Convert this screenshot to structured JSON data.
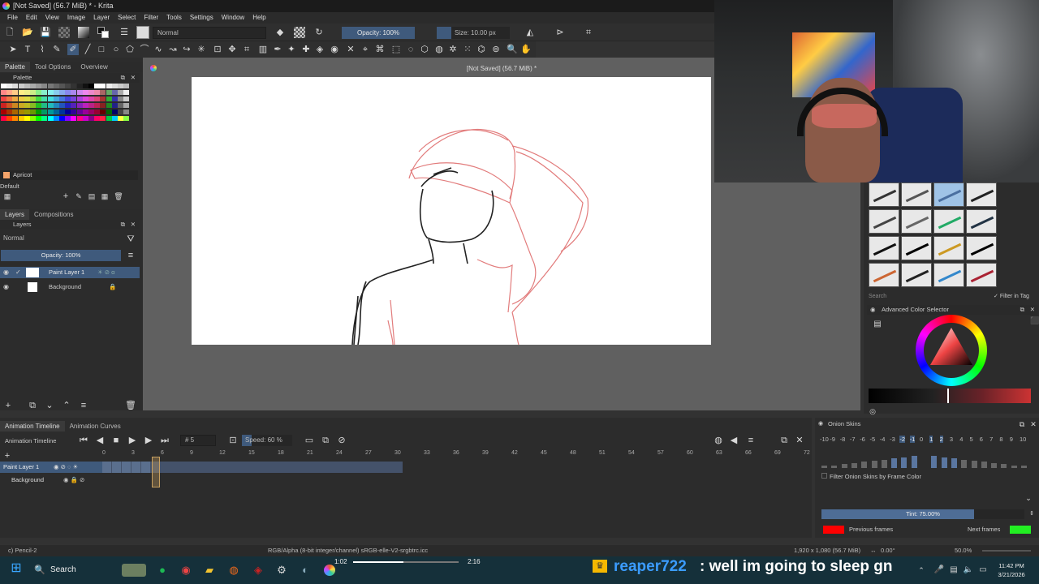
{
  "window": {
    "title": "[Not Saved]  (56.7 MiB) * - Krita"
  },
  "menu": [
    "File",
    "Edit",
    "View",
    "Image",
    "Layer",
    "Select",
    "Filter",
    "Tools",
    "Settings",
    "Window",
    "Help"
  ],
  "toolbar": {
    "blend_mode": "Normal",
    "opacity_label": "Opacity: 100%",
    "size_label": "Size: 10.00 px"
  },
  "left_tabs": [
    "Palette",
    "Tool Options",
    "Overview"
  ],
  "palette": {
    "title": "Palette",
    "selected_color_name": "Apricot",
    "palette_name": "Default"
  },
  "layers_tabs": [
    "Layers",
    "Compositions"
  ],
  "layers": {
    "title": "Layers",
    "blend_mode": "Normal",
    "opacity_label": "Opacity:  100%",
    "items": [
      {
        "name": "Paint Layer 1"
      },
      {
        "name": "Background"
      }
    ]
  },
  "document": {
    "title": "[Not Saved]  (56.7 MiB) *"
  },
  "brush_presets": {
    "search_placeholder": "Search",
    "filter_in_tag": "Filter in Tag"
  },
  "color_selector": {
    "title": "Advanced Color Selector"
  },
  "timeline": {
    "tabs": [
      "Animation Timeline",
      "Animation Curves"
    ],
    "title": "Animation Timeline",
    "frame_field": "5",
    "speed_label": "Speed: 60 %",
    "ruler": [
      "0",
      "3",
      "6",
      "9",
      "12",
      "15",
      "18",
      "21",
      "24",
      "27",
      "30",
      "33",
      "36",
      "39",
      "42",
      "45",
      "48",
      "51",
      "54",
      "57",
      "60",
      "63",
      "66",
      "69",
      "72"
    ],
    "layers": [
      "Paint Layer 1",
      "Background"
    ]
  },
  "onion": {
    "title": "Onion Skins",
    "numbers": [
      "-10",
      "-9",
      "-8",
      "-7",
      "-6",
      "-5",
      "-4",
      "-3",
      "-2",
      "-1",
      "0",
      "1",
      "2",
      "3",
      "4",
      "5",
      "6",
      "7",
      "8",
      "9",
      "10"
    ],
    "filter_label": "Filter Onion Skins by Frame Color",
    "tint_label": "Tint: 75.00%",
    "tint_level": 0.75,
    "previous_label": "Previous frames",
    "next_label": "Next frames",
    "previous_color": "#ff0000",
    "next_color": "#22ee22"
  },
  "status": {
    "tool": "c) Pencil-2",
    "color_model": "RGB/Alpha (8-bit integer/channel)  sRGB-elle-V2-srgbtrc.icc",
    "image_size": "1,920 x 1,080 (56.7 MiB)",
    "rotation": "0.00°",
    "zoom": "50.0%"
  },
  "media": {
    "elapsed": "1:02",
    "total": "2:16"
  },
  "chat": {
    "user": "reaper722",
    "message": ": well im going to sleep gn"
  },
  "taskbar": {
    "search_label": "Search",
    "time": "11:42 PM",
    "date": "3/21/2026"
  }
}
